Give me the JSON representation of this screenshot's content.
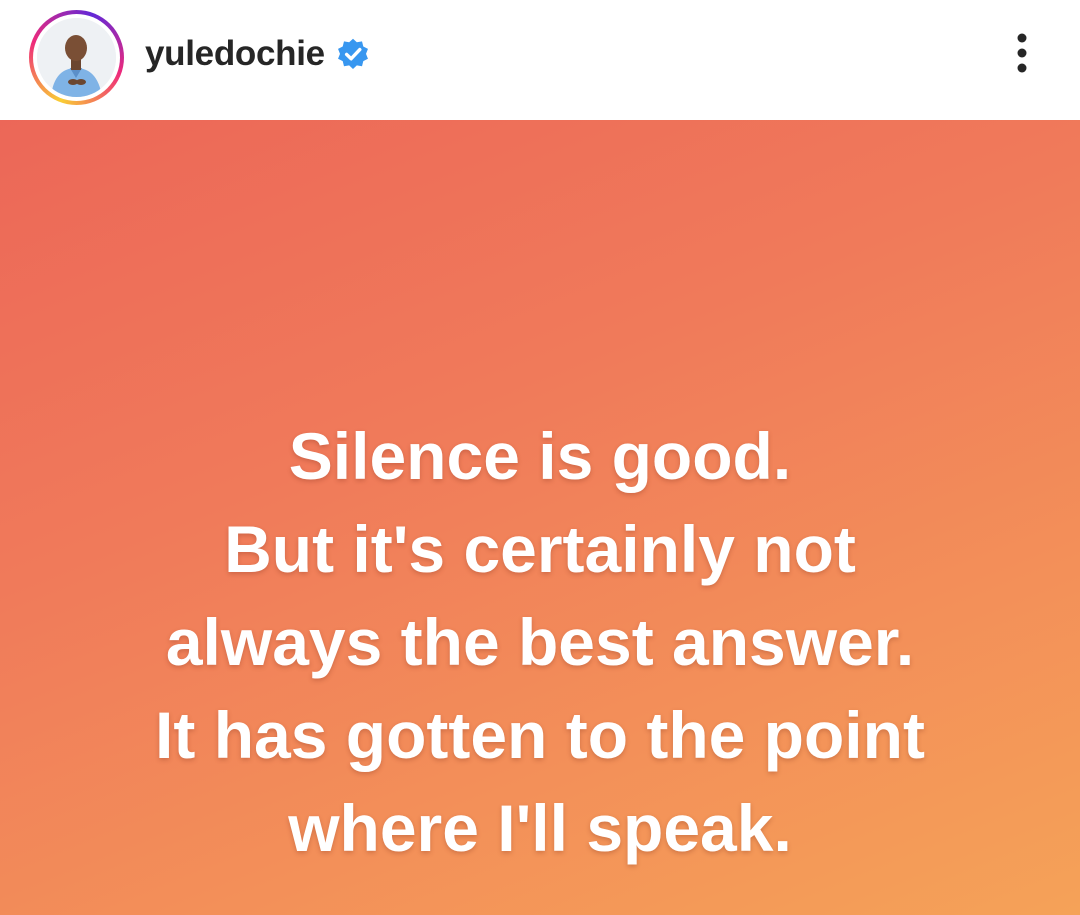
{
  "post": {
    "username": "yuledochie",
    "verified": true,
    "quote_lines": [
      "Silence is good.",
      "But it's certainly not",
      "always the best answer.",
      "It has gotten to the point",
      "where I'll speak."
    ]
  },
  "icons": {
    "verified": "verified-badge-icon",
    "more": "more-vertical-icon"
  },
  "colors": {
    "verified_blue": "#3897f0",
    "username_text": "#262626",
    "background_top_left": "#ec6758",
    "background_bottom_right": "#f5a258",
    "quote_text": "#ffffff"
  }
}
